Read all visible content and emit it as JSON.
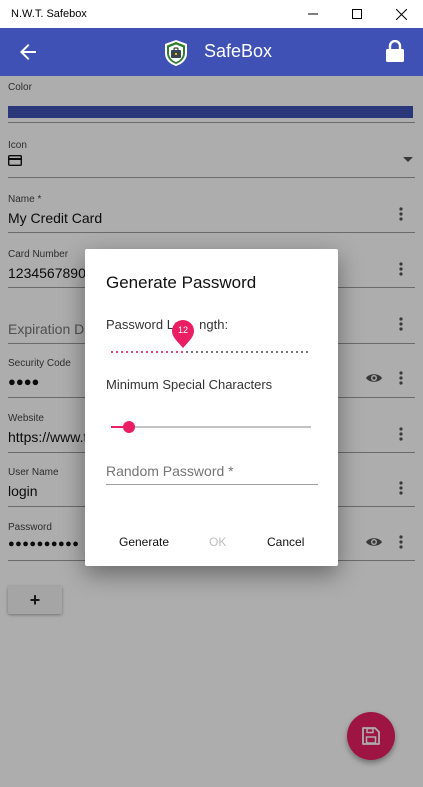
{
  "window": {
    "title": "N.W.T. Safebox",
    "minimize_icon": "minimize-icon",
    "maximize_icon": "maximize-icon",
    "close_icon": "close-icon"
  },
  "appbar": {
    "title": "SafeBox",
    "back_icon": "arrow-left-icon",
    "logo_icon": "safebox-shield-icon",
    "lock_icon": "lock-icon",
    "color": "#3f51b5"
  },
  "form": {
    "color_label": "Color",
    "color_value": "#3f51b5",
    "icon_label": "Icon",
    "icon_value": "credit-card-icon",
    "name_label": "Name *",
    "name_value": "My Credit Card",
    "card_number_label": "Card Number",
    "card_number_value": "1234567890",
    "expiration_placeholder": "Expiration Da",
    "security_code_label": "Security Code",
    "security_code_value": "●●●●",
    "website_label": "Website",
    "website_value": "https://www.t",
    "username_label": "User Name",
    "username_value": "login",
    "password_label": "Password",
    "password_value": "●●●●●●●●●●",
    "add_label": "+",
    "save_icon": "save-icon",
    "accent": "#e91e63"
  },
  "dialog": {
    "title": "Generate Password",
    "length_label_left": "Password Le",
    "length_label_right": "ngth:",
    "length_value": "12",
    "length_fraction": 0.36,
    "special_label": "Minimum  Special Characters",
    "special_fraction": 0.09,
    "random_placeholder": "Random Password *",
    "generate_label": "Generate",
    "ok_label": "OK",
    "cancel_label": "Cancel"
  }
}
